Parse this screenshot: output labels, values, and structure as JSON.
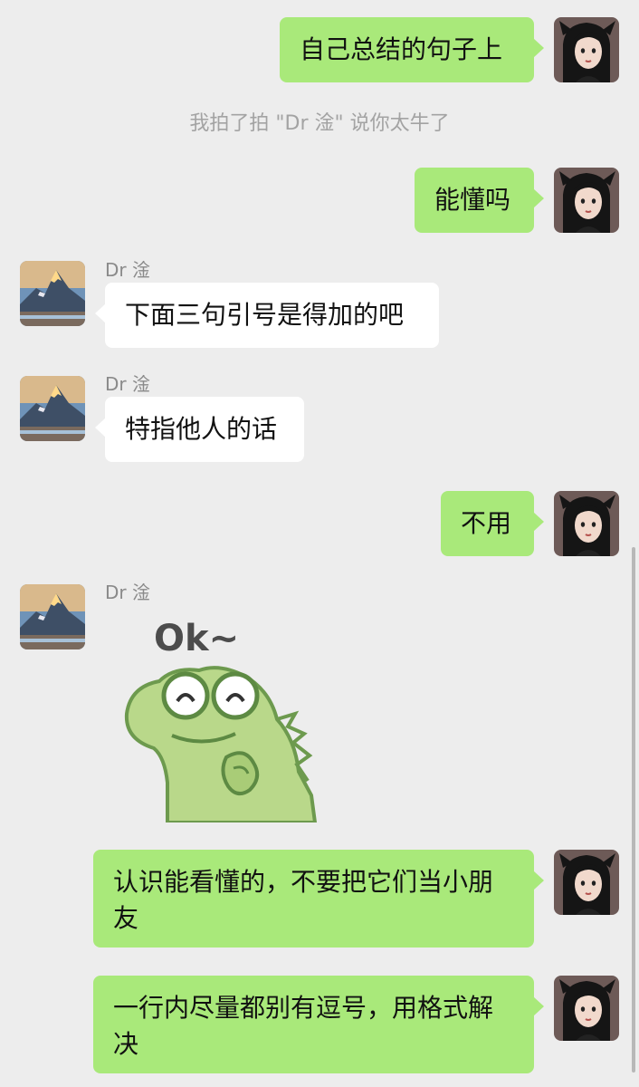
{
  "messages": {
    "m1": "自己总结的句子上",
    "system": "我拍了拍 \"Dr 淦\" 说你太牛了",
    "m2": "能懂吗",
    "m3_sender": "Dr 淦",
    "m3": "下面三句引号是得加的吧",
    "m4_sender": "Dr 淦",
    "m4": "特指他人的话",
    "m5": "不用",
    "m6_sender": "Dr 淦",
    "sticker_text": "Ok~",
    "m7_line1": "认识能看懂的，不要把它们当小朋",
    "m7_line2": "友",
    "m8_line1": "一行内尽量都别有逗号，用格式解",
    "m8_line2": "决"
  },
  "colors": {
    "background": "#ededed",
    "outgoing_bubble": "#a9e97a",
    "incoming_bubble": "#ffffff",
    "system_text": "#a3a3a3",
    "sender_text": "#8a8a8a"
  },
  "icons": {
    "self_avatar": "girl-portrait-avatar",
    "contact_avatar": "mountain-landscape-avatar",
    "sticker": "green-dinosaur-ok-sticker"
  }
}
